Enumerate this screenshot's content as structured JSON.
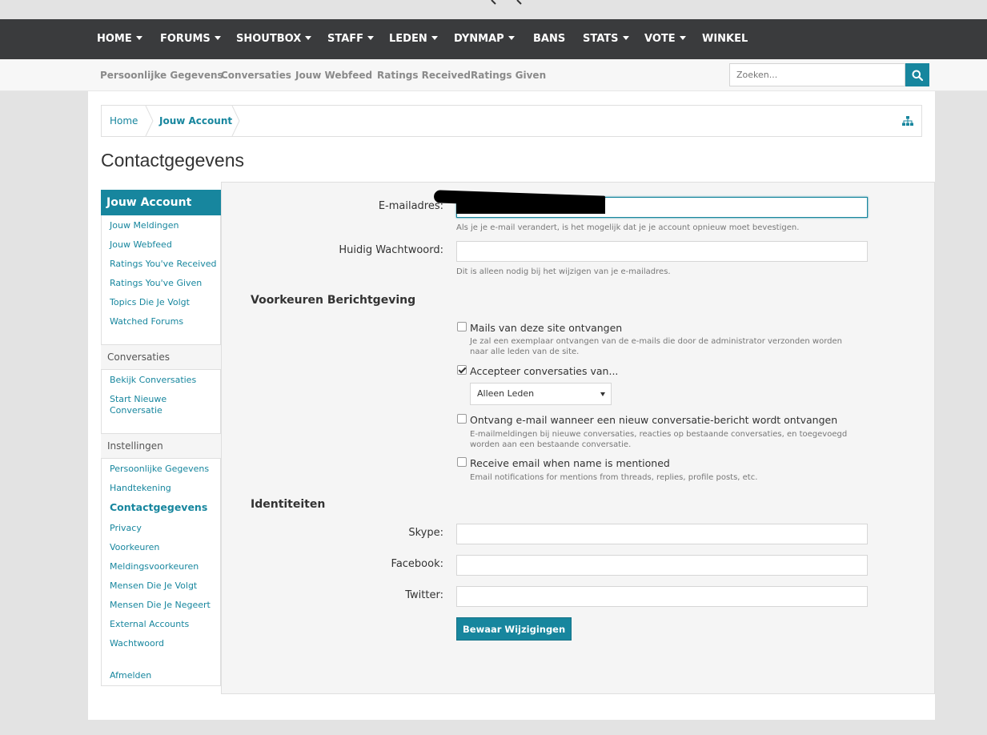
{
  "nav": {
    "tabs": [
      {
        "label": "HOME",
        "caret": true
      },
      {
        "label": "FORUMS",
        "caret": true
      },
      {
        "label": "SHOUTBOX",
        "caret": true
      },
      {
        "label": "STAFF",
        "caret": true
      },
      {
        "label": "LEDEN",
        "caret": true
      },
      {
        "label": "DYNMAP",
        "caret": true
      },
      {
        "label": "BANS",
        "caret": false
      },
      {
        "label": "STATS",
        "caret": true
      },
      {
        "label": "VOTE",
        "caret": true
      },
      {
        "label": "WINKEL",
        "caret": false
      }
    ]
  },
  "subnav": {
    "links": [
      "Persoonlijke Gegevens",
      "Conversaties",
      "Jouw Webfeed",
      "Ratings Received",
      "Ratings Given"
    ],
    "search_placeholder": "Zoeken..."
  },
  "breadcrumb": {
    "items": [
      "Home",
      "Jouw Account"
    ]
  },
  "page": {
    "title": "Contactgegevens"
  },
  "sidebar": {
    "header": "Jouw Account",
    "account_links": [
      "Jouw Meldingen",
      "Jouw Webfeed",
      "Ratings You've Received",
      "Ratings You've Given",
      "Topics Die Je Volgt",
      "Watched Forums"
    ],
    "conversations_header": "Conversaties",
    "conversation_links": [
      "Bekijk Conversaties",
      "Start Nieuwe Conversatie"
    ],
    "settings_header": "Instellingen",
    "settings_links": [
      "Persoonlijke Gegevens",
      "Handtekening",
      "Contactgegevens",
      "Privacy",
      "Voorkeuren",
      "Meldingsvoorkeuren",
      "Mensen Die Je Volgt",
      "Mensen Die Je Negeert",
      "External Accounts",
      "Wachtwoord"
    ],
    "active_link": "Contactgegevens",
    "logout": "Afmelden"
  },
  "form": {
    "email": {
      "label": "E-mailadres:",
      "value": "",
      "hint": "Als je je e-mail verandert, is het mogelijk dat je je account opnieuw moet bevestigen."
    },
    "password": {
      "label": "Huidig Wachtwoord:",
      "value": "",
      "hint": "Dit is alleen nodig bij het wijzigen van je e-mailadres."
    },
    "notifications_title": "Voorkeuren Berichtgeving",
    "options": [
      {
        "label": "Mails van deze site ontvangen",
        "checked": false,
        "hint": "Je zal een exemplaar ontvangen van de e-mails die door de administrator verzonden worden naar alle leden van de site."
      },
      {
        "label": "Accepteer conversaties van...",
        "checked": true,
        "hint": ""
      },
      {
        "label": "Ontvang e-mail wanneer een nieuw conversatie-bericht wordt ontvangen",
        "checked": false,
        "hint": "E-mailmeldingen bij nieuwe conversaties, reacties op bestaande conversaties, en toegevoegd worden aan een bestaande conversatie."
      },
      {
        "label": "Receive email when name is mentioned",
        "checked": false,
        "hint": "Email notifications for mentions from threads, replies, profile posts, etc."
      }
    ],
    "conversation_select": "Alleen Leden",
    "identities_title": "Identiteiten",
    "skype_label": "Skype:",
    "facebook_label": "Facebook:",
    "twitter_label": "Twitter:",
    "save_label": "Bewaar Wijzigingen"
  },
  "colors": {
    "accent": "#17869e",
    "nav_bg": "#3a3b3d"
  }
}
